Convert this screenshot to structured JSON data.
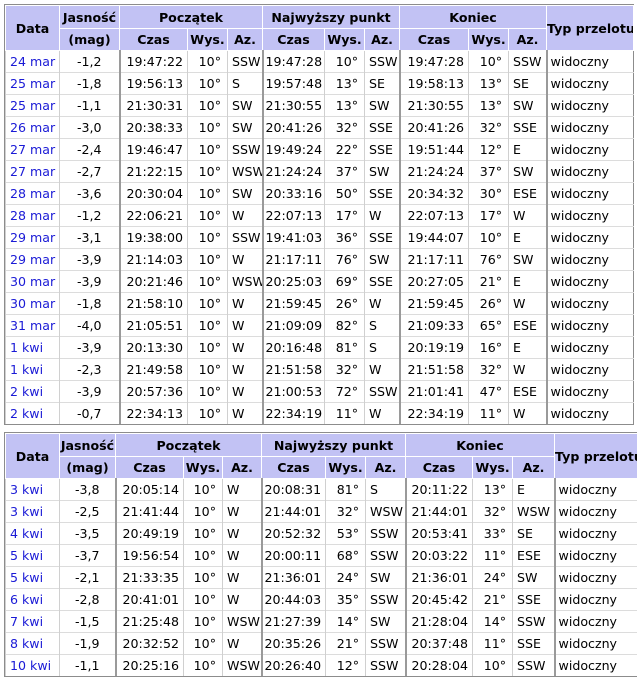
{
  "headers": {
    "date": "Data",
    "mag": "Jasność",
    "mag_unit": "(mag)",
    "start": "Początek",
    "max": "Najwyższy punkt",
    "end": "Koniec",
    "type": "Typ przelotu",
    "time": "Czas",
    "alt": "Wys.",
    "az": "Az."
  },
  "table1": [
    {
      "date": "24 mar",
      "mag": "-1,2",
      "s_time": "19:47:22",
      "s_alt": "10°",
      "s_az": "SSW",
      "m_time": "19:47:28",
      "m_alt": "10°",
      "m_az": "SSW",
      "e_time": "19:47:28",
      "e_alt": "10°",
      "e_az": "SSW",
      "type": "widoczny"
    },
    {
      "date": "25 mar",
      "mag": "-1,8",
      "s_time": "19:56:13",
      "s_alt": "10°",
      "s_az": "S",
      "m_time": "19:57:48",
      "m_alt": "13°",
      "m_az": "SE",
      "e_time": "19:58:13",
      "e_alt": "13°",
      "e_az": "SE",
      "type": "widoczny"
    },
    {
      "date": "25 mar",
      "mag": "-1,1",
      "s_time": "21:30:31",
      "s_alt": "10°",
      "s_az": "SW",
      "m_time": "21:30:55",
      "m_alt": "13°",
      "m_az": "SW",
      "e_time": "21:30:55",
      "e_alt": "13°",
      "e_az": "SW",
      "type": "widoczny"
    },
    {
      "date": "26 mar",
      "mag": "-3,0",
      "s_time": "20:38:33",
      "s_alt": "10°",
      "s_az": "SW",
      "m_time": "20:41:26",
      "m_alt": "32°",
      "m_az": "SSE",
      "e_time": "20:41:26",
      "e_alt": "32°",
      "e_az": "SSE",
      "type": "widoczny"
    },
    {
      "date": "27 mar",
      "mag": "-2,4",
      "s_time": "19:46:47",
      "s_alt": "10°",
      "s_az": "SSW",
      "m_time": "19:49:24",
      "m_alt": "22°",
      "m_az": "SSE",
      "e_time": "19:51:44",
      "e_alt": "12°",
      "e_az": "E",
      "type": "widoczny"
    },
    {
      "date": "27 mar",
      "mag": "-2,7",
      "s_time": "21:22:15",
      "s_alt": "10°",
      "s_az": "WSW",
      "m_time": "21:24:24",
      "m_alt": "37°",
      "m_az": "SW",
      "e_time": "21:24:24",
      "e_alt": "37°",
      "e_az": "SW",
      "type": "widoczny"
    },
    {
      "date": "28 mar",
      "mag": "-3,6",
      "s_time": "20:30:04",
      "s_alt": "10°",
      "s_az": "SW",
      "m_time": "20:33:16",
      "m_alt": "50°",
      "m_az": "SSE",
      "e_time": "20:34:32",
      "e_alt": "30°",
      "e_az": "ESE",
      "type": "widoczny"
    },
    {
      "date": "28 mar",
      "mag": "-1,2",
      "s_time": "22:06:21",
      "s_alt": "10°",
      "s_az": "W",
      "m_time": "22:07:13",
      "m_alt": "17°",
      "m_az": "W",
      "e_time": "22:07:13",
      "e_alt": "17°",
      "e_az": "W",
      "type": "widoczny"
    },
    {
      "date": "29 mar",
      "mag": "-3,1",
      "s_time": "19:38:00",
      "s_alt": "10°",
      "s_az": "SSW",
      "m_time": "19:41:03",
      "m_alt": "36°",
      "m_az": "SSE",
      "e_time": "19:44:07",
      "e_alt": "10°",
      "e_az": "E",
      "type": "widoczny"
    },
    {
      "date": "29 mar",
      "mag": "-3,9",
      "s_time": "21:14:03",
      "s_alt": "10°",
      "s_az": "W",
      "m_time": "21:17:11",
      "m_alt": "76°",
      "m_az": "SW",
      "e_time": "21:17:11",
      "e_alt": "76°",
      "e_az": "SW",
      "type": "widoczny"
    },
    {
      "date": "30 mar",
      "mag": "-3,9",
      "s_time": "20:21:46",
      "s_alt": "10°",
      "s_az": "WSW",
      "m_time": "20:25:03",
      "m_alt": "69°",
      "m_az": "SSE",
      "e_time": "20:27:05",
      "e_alt": "21°",
      "e_az": "E",
      "type": "widoczny"
    },
    {
      "date": "30 mar",
      "mag": "-1,8",
      "s_time": "21:58:10",
      "s_alt": "10°",
      "s_az": "W",
      "m_time": "21:59:45",
      "m_alt": "26°",
      "m_az": "W",
      "e_time": "21:59:45",
      "e_alt": "26°",
      "e_az": "W",
      "type": "widoczny"
    },
    {
      "date": "31 mar",
      "mag": "-4,0",
      "s_time": "21:05:51",
      "s_alt": "10°",
      "s_az": "W",
      "m_time": "21:09:09",
      "m_alt": "82°",
      "m_az": "S",
      "e_time": "21:09:33",
      "e_alt": "65°",
      "e_az": "ESE",
      "type": "widoczny"
    },
    {
      "date": "1 kwi",
      "mag": "-3,9",
      "s_time": "20:13:30",
      "s_alt": "10°",
      "s_az": "W",
      "m_time": "20:16:48",
      "m_alt": "81°",
      "m_az": "S",
      "e_time": "20:19:19",
      "e_alt": "16°",
      "e_az": "E",
      "type": "widoczny"
    },
    {
      "date": "1 kwi",
      "mag": "-2,3",
      "s_time": "21:49:58",
      "s_alt": "10°",
      "s_az": "W",
      "m_time": "21:51:58",
      "m_alt": "32°",
      "m_az": "W",
      "e_time": "21:51:58",
      "e_alt": "32°",
      "e_az": "W",
      "type": "widoczny"
    },
    {
      "date": "2 kwi",
      "mag": "-3,9",
      "s_time": "20:57:36",
      "s_alt": "10°",
      "s_az": "W",
      "m_time": "21:00:53",
      "m_alt": "72°",
      "m_az": "SSW",
      "e_time": "21:01:41",
      "e_alt": "47°",
      "e_az": "ESE",
      "type": "widoczny"
    },
    {
      "date": "2 kwi",
      "mag": "-0,7",
      "s_time": "22:34:13",
      "s_alt": "10°",
      "s_az": "W",
      "m_time": "22:34:19",
      "m_alt": "11°",
      "m_az": "W",
      "e_time": "22:34:19",
      "e_alt": "11°",
      "e_az": "W",
      "type": "widoczny"
    }
  ],
  "table2": [
    {
      "date": "3 kwi",
      "mag": "-3,8",
      "s_time": "20:05:14",
      "s_alt": "10°",
      "s_az": "W",
      "m_time": "20:08:31",
      "m_alt": "81°",
      "m_az": "S",
      "e_time": "20:11:22",
      "e_alt": "13°",
      "e_az": "E",
      "type": "widoczny"
    },
    {
      "date": "3 kwi",
      "mag": "-2,5",
      "s_time": "21:41:44",
      "s_alt": "10°",
      "s_az": "W",
      "m_time": "21:44:01",
      "m_alt": "32°",
      "m_az": "WSW",
      "e_time": "21:44:01",
      "e_alt": "32°",
      "e_az": "WSW",
      "type": "widoczny"
    },
    {
      "date": "4 kwi",
      "mag": "-3,5",
      "s_time": "20:49:19",
      "s_alt": "10°",
      "s_az": "W",
      "m_time": "20:52:32",
      "m_alt": "53°",
      "m_az": "SSW",
      "e_time": "20:53:41",
      "e_alt": "33°",
      "e_az": "SE",
      "type": "widoczny"
    },
    {
      "date": "5 kwi",
      "mag": "-3,7",
      "s_time": "19:56:54",
      "s_alt": "10°",
      "s_az": "W",
      "m_time": "20:00:11",
      "m_alt": "68°",
      "m_az": "SSW",
      "e_time": "20:03:22",
      "e_alt": "11°",
      "e_az": "ESE",
      "type": "widoczny"
    },
    {
      "date": "5 kwi",
      "mag": "-2,1",
      "s_time": "21:33:35",
      "s_alt": "10°",
      "s_az": "W",
      "m_time": "21:36:01",
      "m_alt": "24°",
      "m_az": "SW",
      "e_time": "21:36:01",
      "e_alt": "24°",
      "e_az": "SW",
      "type": "widoczny"
    },
    {
      "date": "6 kwi",
      "mag": "-2,8",
      "s_time": "20:41:01",
      "s_alt": "10°",
      "s_az": "W",
      "m_time": "20:44:03",
      "m_alt": "35°",
      "m_az": "SSW",
      "e_time": "20:45:42",
      "e_alt": "21°",
      "e_az": "SSE",
      "type": "widoczny"
    },
    {
      "date": "7 kwi",
      "mag": "-1,5",
      "s_time": "21:25:48",
      "s_alt": "10°",
      "s_az": "WSW",
      "m_time": "21:27:39",
      "m_alt": "14°",
      "m_az": "SW",
      "e_time": "21:28:04",
      "e_alt": "14°",
      "e_az": "SSW",
      "type": "widoczny"
    },
    {
      "date": "8 kwi",
      "mag": "-1,9",
      "s_time": "20:32:52",
      "s_alt": "10°",
      "s_az": "W",
      "m_time": "20:35:26",
      "m_alt": "21°",
      "m_az": "SSW",
      "e_time": "20:37:48",
      "e_alt": "11°",
      "e_az": "SSE",
      "type": "widoczny"
    },
    {
      "date": "10 kwi",
      "mag": "-1,1",
      "s_time": "20:25:16",
      "s_alt": "10°",
      "s_az": "WSW",
      "m_time": "20:26:40",
      "m_alt": "12°",
      "m_az": "SSW",
      "e_time": "20:28:04",
      "e_alt": "10°",
      "e_az": "SSW",
      "type": "widoczny"
    }
  ]
}
